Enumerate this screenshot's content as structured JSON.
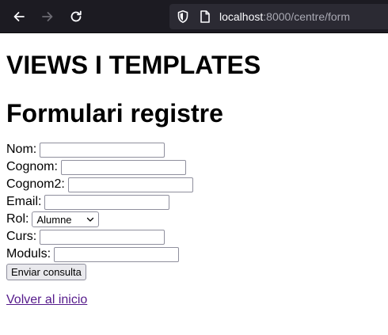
{
  "browser": {
    "url_host": "localhost",
    "url_rest": ":8000/centre/form"
  },
  "page": {
    "heading1": "VIEWS I TEMPLATES",
    "heading2": "Formulari registre"
  },
  "form": {
    "fields": {
      "nom": {
        "label": "Nom:",
        "value": ""
      },
      "cognom": {
        "label": "Cognom:",
        "value": ""
      },
      "cognom2": {
        "label": "Cognom2:",
        "value": ""
      },
      "email": {
        "label": "Email:",
        "value": ""
      },
      "rol": {
        "label": "Rol:",
        "selected": "Alumne"
      },
      "curs": {
        "label": "Curs:",
        "value": ""
      },
      "moduls": {
        "label": "Moduls:",
        "value": ""
      }
    },
    "submit_label": "Enviar consulta"
  },
  "link": {
    "back_label": "Volver al inicio"
  }
}
